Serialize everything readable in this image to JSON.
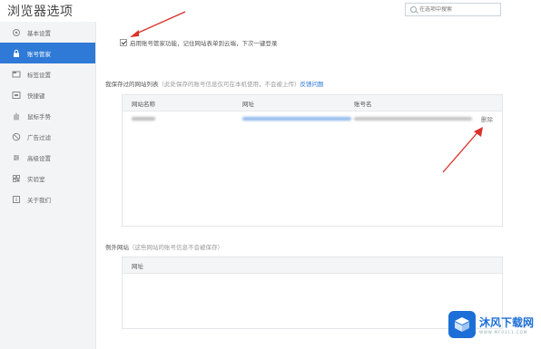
{
  "window": {
    "title": "浏览器选项"
  },
  "search": {
    "placeholder": "在选项中搜索"
  },
  "sidebar": {
    "items": [
      {
        "label": "基本设置",
        "icon": "gear-icon",
        "active": false
      },
      {
        "label": "账号管家",
        "icon": "lock-icon",
        "active": true
      },
      {
        "label": "标签设置",
        "icon": "tab-icon",
        "active": false
      },
      {
        "label": "快捷键",
        "icon": "keyboard-icon",
        "active": false
      },
      {
        "label": "鼠标手势",
        "icon": "hand-icon",
        "active": false
      },
      {
        "label": "广告过滤",
        "icon": "block-icon",
        "active": false
      },
      {
        "label": "高级设置",
        "icon": "settings-icon",
        "active": false
      },
      {
        "label": "实验室",
        "icon": "lab-icon",
        "active": false
      },
      {
        "label": "关于我们",
        "icon": "info-icon",
        "active": false
      }
    ]
  },
  "account": {
    "enable_label": "启用账号管家功能，记住网站表单到云端，下次一键登录",
    "enabled": true,
    "saved_section": {
      "label": "我保存过的网站列表",
      "hint": "（此处保存的账号信息仅可在本机使用，不会被上传）",
      "link": "反馈问题",
      "headers": {
        "site": "网站名称",
        "url": "网址",
        "account": "账号名"
      },
      "rows": [
        {
          "site": "",
          "url": "",
          "account": "",
          "delete_label": "删除"
        }
      ]
    },
    "exception_section": {
      "label": "例外网站",
      "hint": "（这些网站的账号信息不会被保存）",
      "headers": {
        "url": "网址"
      }
    }
  },
  "watermark": {
    "text": "沐风下载网",
    "sub": "WWW.MF0311.COM"
  },
  "colors": {
    "accent": "#2e7ad6",
    "annotation": "#d9322a"
  }
}
